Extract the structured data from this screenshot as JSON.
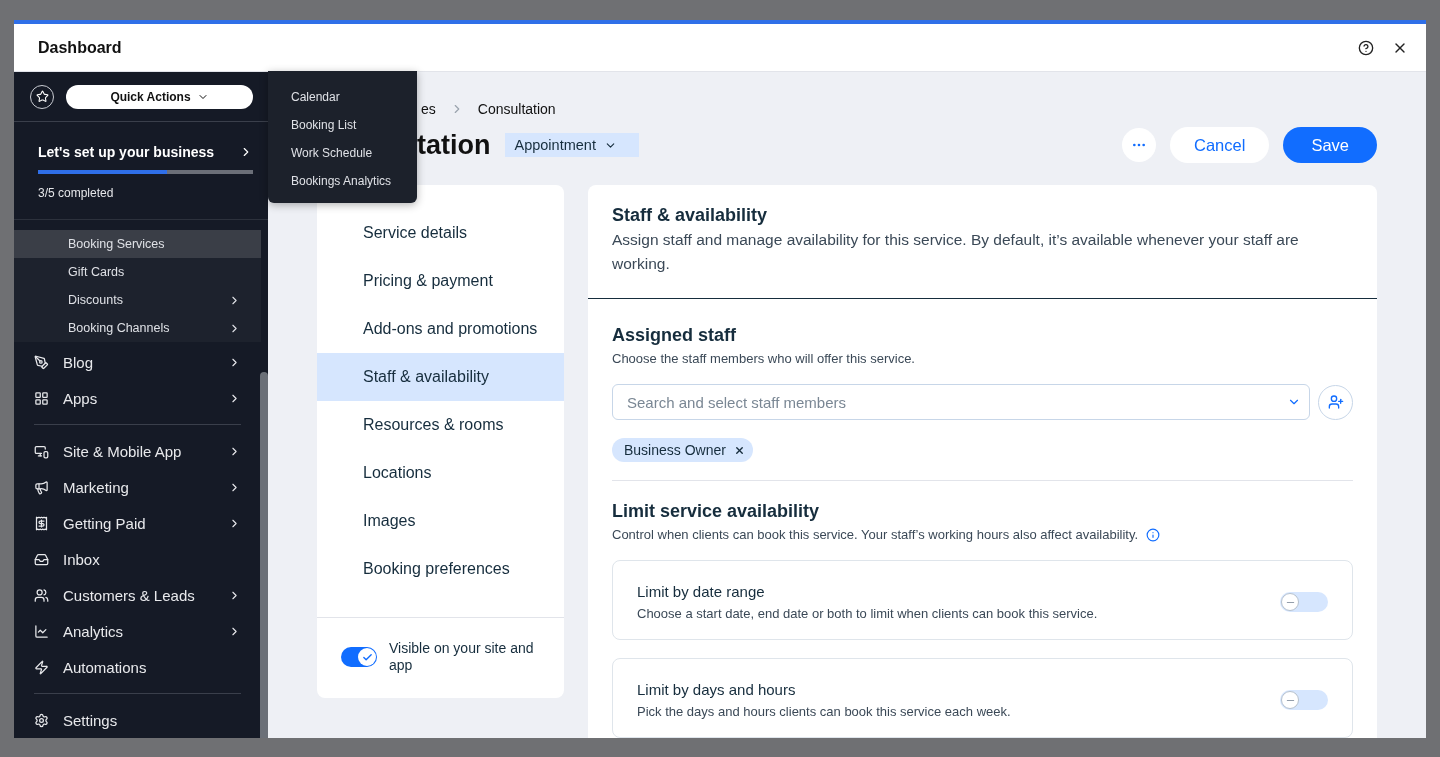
{
  "window": {
    "title": "Dashboard"
  },
  "sidebar": {
    "quick_actions": "Quick Actions",
    "setup": {
      "title": "Let's set up your business",
      "level": 0.6,
      "progress_text": "3/5 completed"
    },
    "subitems": [
      {
        "label": "Booking Services",
        "selected": true,
        "has_children": false
      },
      {
        "label": "Gift Cards",
        "selected": false,
        "has_children": false
      },
      {
        "label": "Discounts",
        "selected": false,
        "has_children": true
      },
      {
        "label": "Booking Channels",
        "selected": false,
        "has_children": true
      }
    ],
    "groups": [
      [
        {
          "label": "Blog",
          "has_children": true
        },
        {
          "label": "Apps",
          "has_children": true
        }
      ],
      [
        {
          "label": "Site & Mobile App",
          "has_children": true
        },
        {
          "label": "Marketing",
          "has_children": true
        },
        {
          "label": "Getting Paid",
          "has_children": true
        },
        {
          "label": "Inbox",
          "has_children": false
        },
        {
          "label": "Customers & Leads",
          "has_children": true
        },
        {
          "label": "Analytics",
          "has_children": true
        },
        {
          "label": "Automations",
          "has_children": false
        }
      ],
      [
        {
          "label": "Settings",
          "has_children": false
        }
      ]
    ]
  },
  "quick_actions_menu": [
    "Calendar",
    "Booking List",
    "Work Schedule",
    "Bookings Analytics"
  ],
  "breadcrumb": [
    "es",
    "Consultation"
  ],
  "page_title": "tation",
  "service_type": "Appointment",
  "actions": {
    "cancel": "Cancel",
    "save": "Save"
  },
  "nav": [
    {
      "label": "Service details",
      "selected": false
    },
    {
      "label": "Pricing & payment",
      "selected": false
    },
    {
      "label": "Add-ons and promotions",
      "selected": false
    },
    {
      "label": "Staff & availability",
      "selected": true
    },
    {
      "label": "Resources & rooms",
      "selected": false
    },
    {
      "label": "Locations",
      "selected": false
    },
    {
      "label": "Images",
      "selected": false
    },
    {
      "label": "Booking preferences",
      "selected": false
    }
  ],
  "visibility": {
    "label": "Visible on your site and app",
    "on": true
  },
  "panel": {
    "title": "Staff & availability",
    "description": "Assign staff and manage availability for this service. By default, it’s available whenever your staff are working.",
    "assigned": {
      "title": "Assigned staff",
      "description": "Choose the staff members who will offer this service.",
      "placeholder": "Search and select staff members",
      "chips": [
        "Business Owner"
      ]
    },
    "limits": {
      "title": "Limit service availability",
      "description": "Control when clients can book this service. Your staff’s working hours also affect availability.",
      "options": [
        {
          "title": "Limit by date range",
          "description": "Choose a start date, end date or both to limit when clients can book this service.",
          "on": false
        },
        {
          "title": "Limit by days and hours",
          "description": "Pick the days and hours clients can book this service each week.",
          "on": false
        }
      ]
    }
  }
}
